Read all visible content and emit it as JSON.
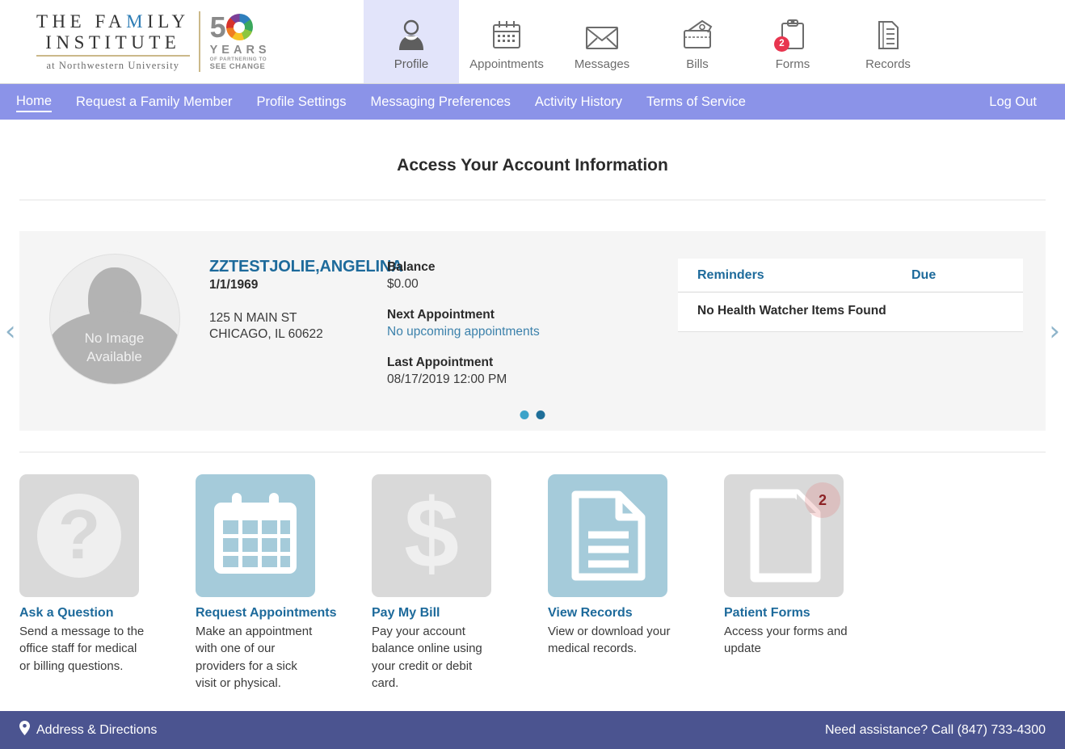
{
  "brand": {
    "line1": "THE FAMILY",
    "line1_accent_index": 8,
    "line2": "INSTITUTE",
    "line3": "at Northwestern University",
    "anniv_number": "5",
    "anniv_years": "YEARS",
    "anniv_sub1": "OF PARTNERING TO",
    "anniv_sub2": "SEE CHANGE"
  },
  "top_nav": {
    "items": [
      {
        "label": "Profile",
        "icon": "person-icon",
        "active": true,
        "badge": null
      },
      {
        "label": "Appointments",
        "icon": "calendar-icon",
        "active": false,
        "badge": null
      },
      {
        "label": "Messages",
        "icon": "envelope-icon",
        "active": false,
        "badge": null
      },
      {
        "label": "Bills",
        "icon": "wallet-icon",
        "active": false,
        "badge": null
      },
      {
        "label": "Forms",
        "icon": "clipboard-icon",
        "active": false,
        "badge": "2"
      },
      {
        "label": "Records",
        "icon": "document-icon",
        "active": false,
        "badge": null
      }
    ]
  },
  "sub_nav": {
    "items": [
      {
        "label": "Home",
        "current": true
      },
      {
        "label": "Request a Family Member",
        "current": false
      },
      {
        "label": "Profile Settings",
        "current": false
      },
      {
        "label": "Messaging Preferences",
        "current": false
      },
      {
        "label": "Activity History",
        "current": false
      },
      {
        "label": "Terms of Service",
        "current": false
      }
    ],
    "logout_label": "Log Out"
  },
  "page": {
    "title": "Access Your Account Information"
  },
  "patient": {
    "avatar_text_line1": "No Image",
    "avatar_text_line2": "Available",
    "name": "ZZTESTJOLIE,ANGELINA",
    "dob": "1/1/1969",
    "address_line1": "125 N MAIN ST",
    "address_line2": "CHICAGO, IL 60622",
    "balance_label": "Balance",
    "balance_value": "$0.00",
    "next_appt_label": "Next Appointment",
    "next_appt_value": "No upcoming appointments",
    "last_appt_label": "Last Appointment",
    "last_appt_value": "08/17/2019 12:00 PM",
    "prev_arrow": "‹",
    "next_arrow": "›",
    "dots": [
      {
        "color": "#3ba3c9",
        "active": true
      },
      {
        "color": "#1f6f99",
        "active": false
      }
    ]
  },
  "reminders": {
    "col_reminders": "Reminders",
    "col_due": "Due",
    "empty_text": "No Health Watcher Items Found"
  },
  "tiles": [
    {
      "title": "Ask a Question",
      "desc": "Send a message to the office staff for medical or billing questions.",
      "icon": "question-mark-icon",
      "style": "gray",
      "badge": null
    },
    {
      "title": "Request Appointments",
      "desc": "Make an appointment with one of our providers for a sick visit or physical.",
      "icon": "calendar-icon",
      "style": "blue",
      "badge": null
    },
    {
      "title": "Pay My Bill",
      "desc": "Pay your account balance online using your credit or debit card.",
      "icon": "dollar-sign-icon",
      "style": "gray",
      "badge": null
    },
    {
      "title": "View Records",
      "desc": "View or download your medical records.",
      "icon": "document-lines-icon",
      "style": "blue",
      "badge": null
    },
    {
      "title": "Patient Forms",
      "desc": "Access your forms and update",
      "icon": "page-fold-icon",
      "style": "gray",
      "badge": "2"
    }
  ],
  "footer": {
    "address_label": "Address & Directions",
    "address_icon": "map-pin-icon",
    "assistance": "Need assistance? Call (847) 733-4300"
  },
  "colors": {
    "subnav_bg": "#8b93e8",
    "footer_bg": "#4b5490",
    "accent_link": "#1d6a9b",
    "tile_blue": "#a5cbda",
    "tile_gray": "#d9d9d9",
    "badge_red": "#e8354f",
    "active_tab_bg": "#e2e4fa"
  }
}
